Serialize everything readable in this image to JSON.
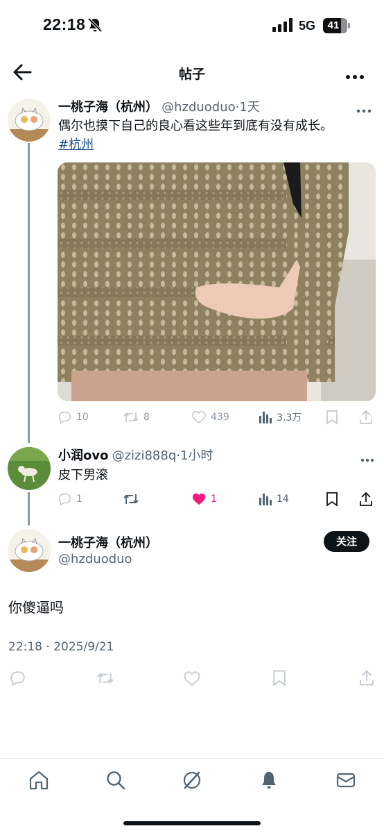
{
  "status_bar": {
    "time": "22:18",
    "network": "5G",
    "battery": "41"
  },
  "header": {
    "title": "帖子"
  },
  "tweet1": {
    "name": "一桃子海（杭州）",
    "handle": "@hzduoduo",
    "time": "·1天",
    "text": "偶尔也摸下自己的良心看这些年到底有没有成长。",
    "hashtag": "#杭州",
    "stats": {
      "replies": "10",
      "retweets": "8",
      "likes": "439",
      "views": "3.3万"
    }
  },
  "reply": {
    "name": "小润ovo",
    "handle": "@zizi888q",
    "time": "·1小时",
    "text": "皮下男滚",
    "stats": {
      "replies": "1",
      "likes": "1",
      "views": "14"
    }
  },
  "main": {
    "name": "一桃子海（杭州）",
    "handle": "@hzduoduo",
    "follow_label": "关注",
    "text": "你傻逼吗",
    "timestamp": "22:18 · 2025/9/21"
  },
  "colors": {
    "like_active": "#f91880",
    "icon_gray": "#8b98a5",
    "link": "#1d4f91"
  }
}
